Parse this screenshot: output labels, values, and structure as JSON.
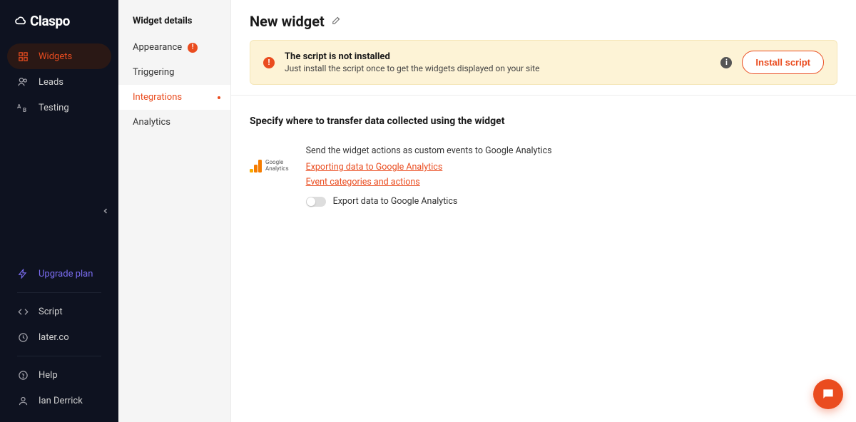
{
  "brand": "Claspo",
  "nav": {
    "widgets": "Widgets",
    "leads": "Leads",
    "testing": "Testing",
    "upgrade": "Upgrade plan",
    "script": "Script",
    "domain": "later.co",
    "help": "Help",
    "user": "Ian Derrick"
  },
  "details": {
    "title": "Widget details",
    "appearance": "Appearance",
    "triggering": "Triggering",
    "integrations": "Integrations",
    "analytics": "Analytics"
  },
  "page": {
    "title": "New widget"
  },
  "banner": {
    "title": "The script is not installed",
    "desc": "Just install the script once to get the widgets displayed on your site",
    "button": "Install script"
  },
  "section": {
    "title": "Specify where to transfer data collected using the widget"
  },
  "ga": {
    "brand1": "Google",
    "brand2": "Analytics",
    "desc": "Send the widget actions as custom events to Google Analytics",
    "link1": "Exporting data to Google Analytics",
    "link2": "Event categories and actions",
    "toggle_label": "Export data to Google Analytics"
  }
}
